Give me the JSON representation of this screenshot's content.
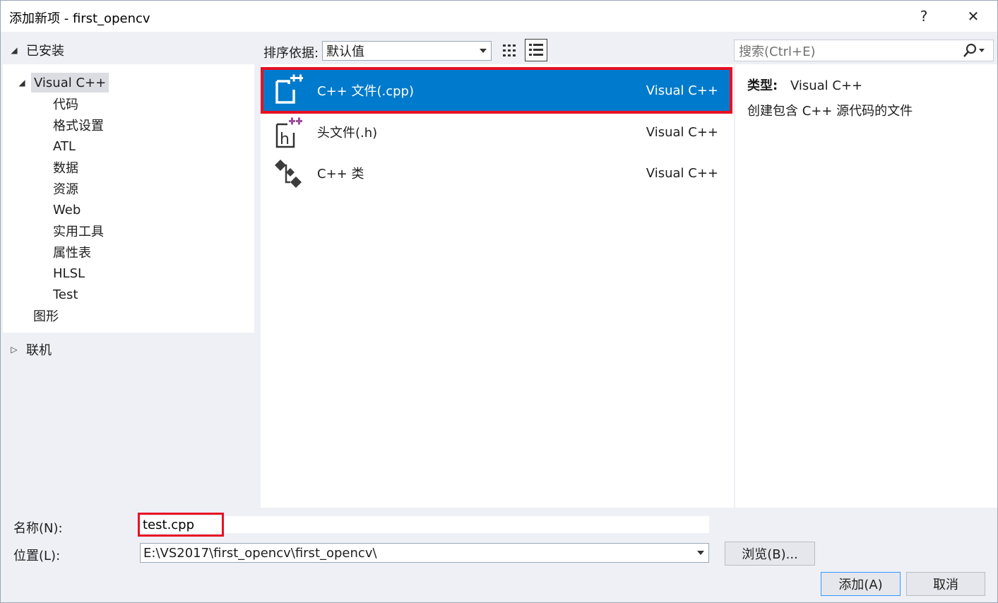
{
  "window": {
    "title": "添加新项 - first_opencv",
    "help_label": "?",
    "close_label": "✕"
  },
  "left": {
    "installed_label": "已安装",
    "tree": [
      {
        "label": "Visual C++",
        "level": 0,
        "expanded": true,
        "selected": true
      },
      {
        "label": "代码",
        "level": 1
      },
      {
        "label": "格式设置",
        "level": 1
      },
      {
        "label": "ATL",
        "level": 1
      },
      {
        "label": "数据",
        "level": 1
      },
      {
        "label": "资源",
        "level": 1
      },
      {
        "label": "Web",
        "level": 1
      },
      {
        "label": "实用工具",
        "level": 1
      },
      {
        "label": "属性表",
        "level": 1
      },
      {
        "label": "HLSL",
        "level": 1
      },
      {
        "label": "Test",
        "level": 1
      },
      {
        "label": "图形",
        "level": 0
      }
    ],
    "online_label": "联机"
  },
  "toolbar": {
    "sort_label": "排序依据:",
    "sort_value": "默认值",
    "search_placeholder": "搜索(Ctrl+E)"
  },
  "items": [
    {
      "name": "C++ 文件(.cpp)",
      "lang": "Visual C++",
      "icon": "cpp-file-icon",
      "selected": true
    },
    {
      "name": "头文件(.h)",
      "lang": "Visual C++",
      "icon": "header-file-icon"
    },
    {
      "name": "C++ 类",
      "lang": "Visual C++",
      "icon": "cpp-class-icon"
    }
  ],
  "details": {
    "type_label": "类型:",
    "type_value": "Visual C++",
    "description": "创建包含 C++ 源代码的文件"
  },
  "form": {
    "name_label": "名称(N):",
    "name_value": "test.cpp",
    "location_label": "位置(L):",
    "location_value": "E:\\VS2017\\first_opencv\\first_opencv\\",
    "browse_label": "浏览(B)...",
    "add_label": "添加(A)",
    "cancel_label": "取消"
  },
  "colors": {
    "selection": "#007acc",
    "highlight_border": "#e81123",
    "plus_purple": "#9b4f96"
  }
}
